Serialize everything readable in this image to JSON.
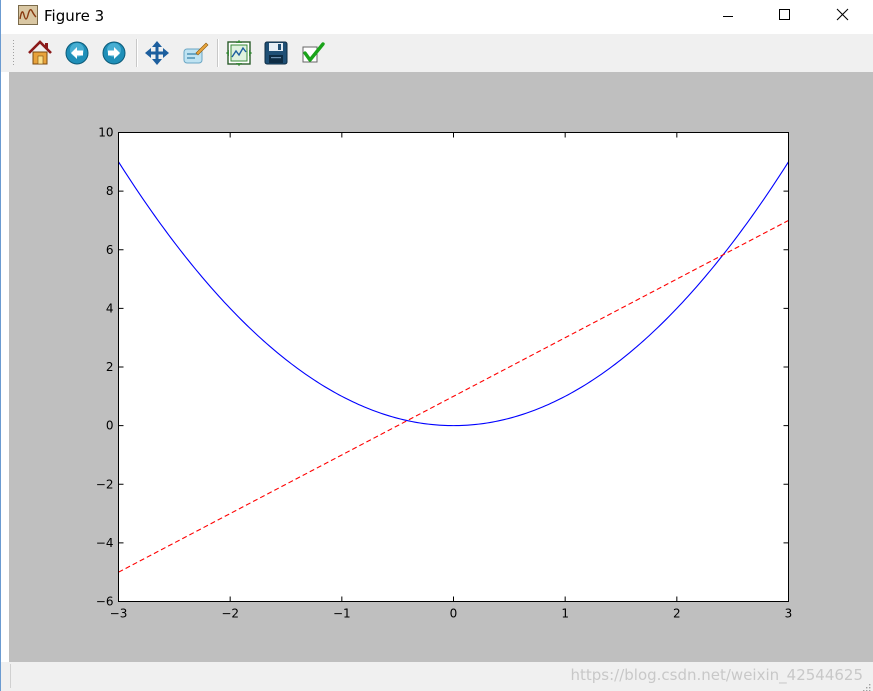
{
  "window": {
    "title": "Figure 3"
  },
  "toolbar": {
    "items": [
      {
        "name": "home-button",
        "icon": "home-icon"
      },
      {
        "name": "back-button",
        "icon": "arrow-left-icon"
      },
      {
        "name": "forward-button",
        "icon": "arrow-right-icon"
      },
      {
        "name": "pan-button",
        "icon": "move-arrows-icon"
      },
      {
        "name": "zoom-button",
        "icon": "zoom-rect-icon"
      },
      {
        "name": "subplots-button",
        "icon": "subplots-icon"
      },
      {
        "name": "save-button",
        "icon": "floppy-disk-icon"
      },
      {
        "name": "edit-button",
        "icon": "checkmark-icon"
      }
    ]
  },
  "status": {
    "watermark": "https://blog.csdn.net/weixin_42544625"
  },
  "colors": {
    "canvas_bg": "#bfbfbf",
    "axes_bg": "#ffffff",
    "series_curve": "#0000ff",
    "series_line": "#ff0000"
  },
  "chart_data": {
    "type": "line",
    "title": "",
    "xlabel": "",
    "ylabel": "",
    "xlim": [
      -3,
      3
    ],
    "ylim": [
      -6,
      10
    ],
    "xticks": [
      -3,
      -2,
      -1,
      0,
      1,
      2,
      3
    ],
    "yticks": [
      -6,
      -4,
      -2,
      0,
      2,
      4,
      6,
      8,
      10
    ],
    "xtick_labels": [
      "−3",
      "−2",
      "−1",
      "0",
      "1",
      "2",
      "3"
    ],
    "ytick_labels": [
      "−6",
      "−4",
      "−2",
      "0",
      "2",
      "4",
      "6",
      "8",
      "10"
    ],
    "grid": false,
    "legend": "none",
    "series": [
      {
        "style": "solid",
        "color": "#0000ff",
        "x": [
          -3,
          -2.5,
          -2,
          -1.5,
          -1,
          -0.5,
          0,
          0.5,
          1,
          1.5,
          2,
          2.5,
          3
        ],
        "y": [
          9,
          6.25,
          4,
          2.25,
          1,
          0.25,
          0,
          0.25,
          1,
          2.25,
          4,
          6.25,
          9
        ]
      },
      {
        "style": "dashed",
        "color": "#ff0000",
        "x": [
          -3,
          3
        ],
        "y": [
          -5,
          7
        ]
      }
    ]
  }
}
